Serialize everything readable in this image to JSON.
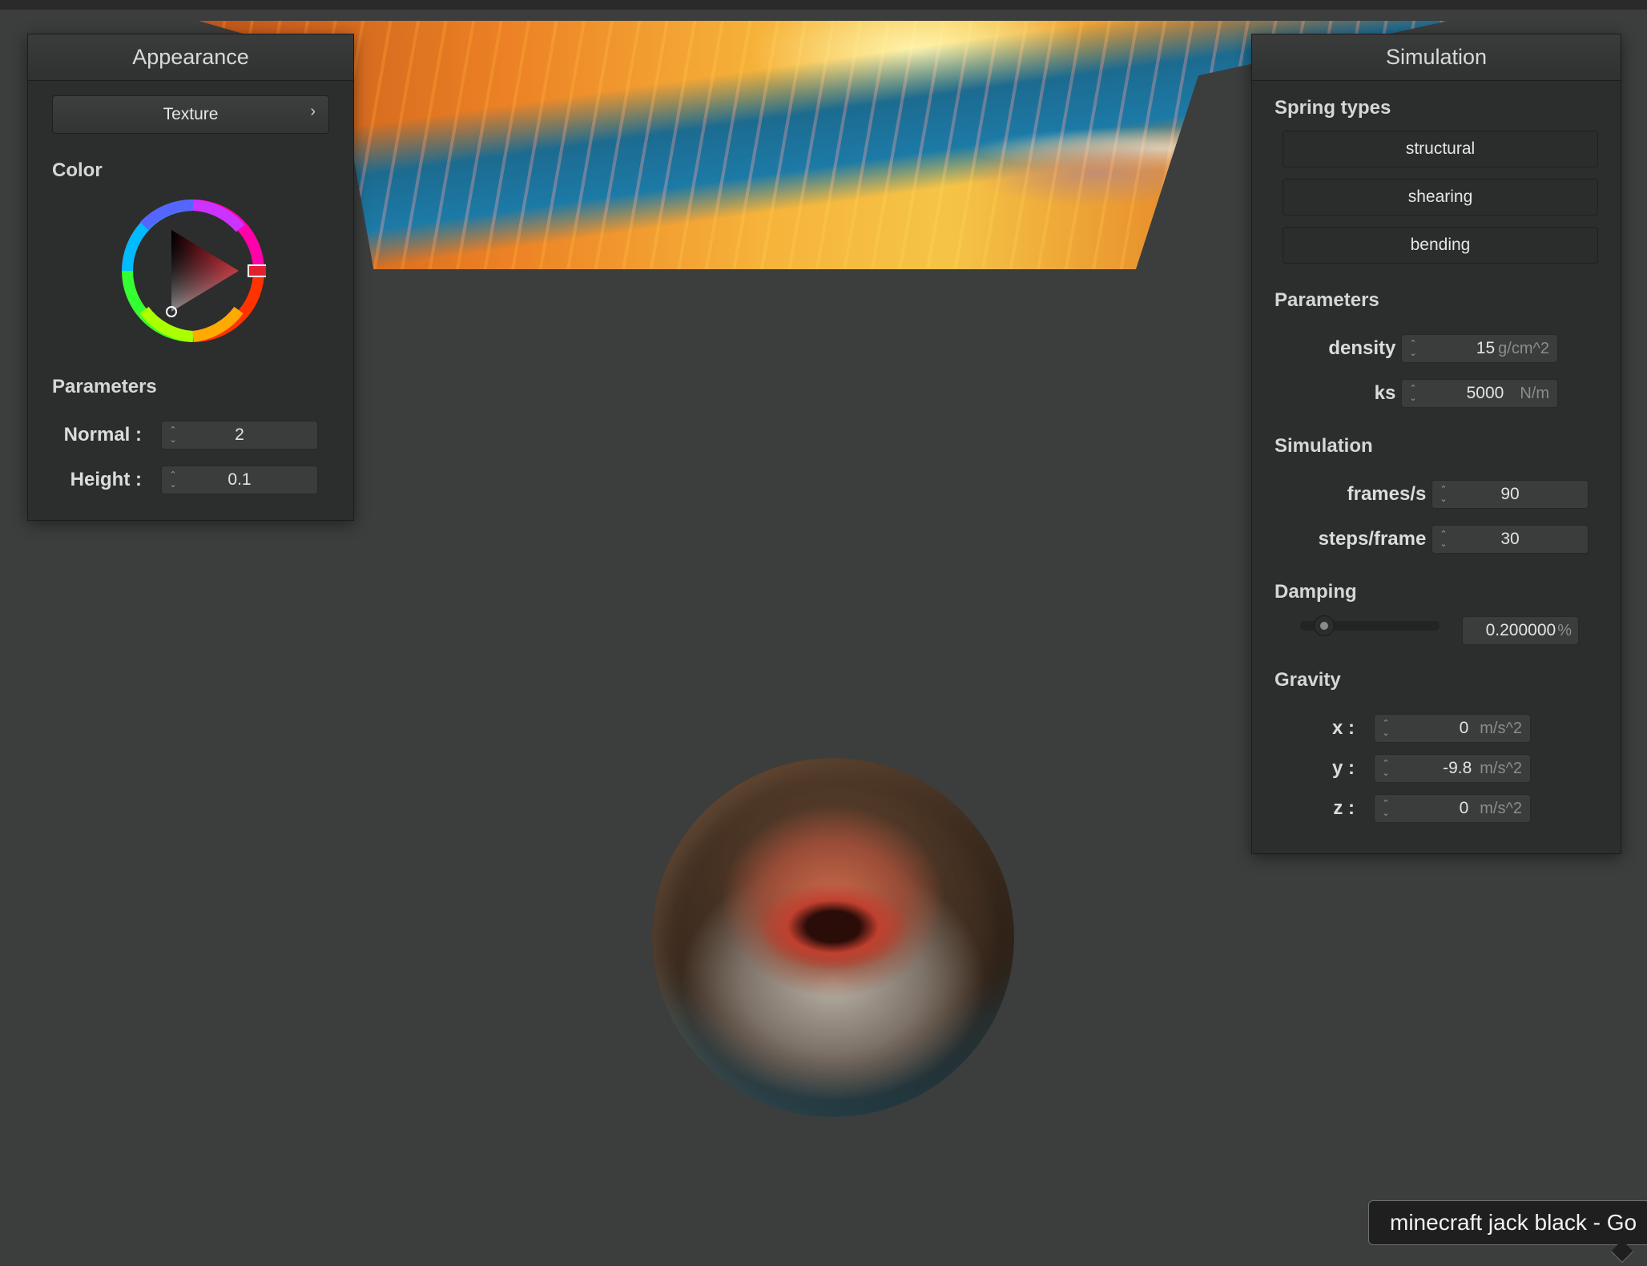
{
  "appearance": {
    "title": "Appearance",
    "texture_button": "Texture",
    "texture_chevron": "›",
    "color_label": "Color",
    "color_wheel": {
      "hue_color": "#e0202e",
      "selected_color": "#b01d24"
    },
    "parameters_label": "Parameters",
    "normal": {
      "label": "Normal :",
      "value": "2"
    },
    "height": {
      "label": "Height :",
      "value": "0.1"
    }
  },
  "simulation": {
    "title": "Simulation",
    "spring_types_label": "Spring types",
    "spring_types": [
      "structural",
      "shearing",
      "bending"
    ],
    "parameters_label": "Parameters",
    "density": {
      "label": "density :",
      "value": "15",
      "unit": "g/cm^2"
    },
    "ks": {
      "label": "ks :",
      "value": "5000",
      "unit": "N/m"
    },
    "simulation_label": "Simulation",
    "frames": {
      "label": "frames/s :",
      "value": "90"
    },
    "steps": {
      "label": "steps/frame :",
      "value": "30"
    },
    "damping_label": "Damping",
    "damping": {
      "value": "0.200000",
      "unit": "%",
      "slider_fraction": 0.2
    },
    "gravity_label": "Gravity",
    "gravity": [
      {
        "label": "x :",
        "value": "0",
        "unit": "m/s^2"
      },
      {
        "label": "y :",
        "value": "-9.8",
        "unit": "m/s^2"
      },
      {
        "label": "z :",
        "value": "0",
        "unit": "m/s^2"
      }
    ]
  },
  "tooltip": {
    "text": "minecraft jack black - Go"
  },
  "icons": {
    "spin_up": "⌃",
    "spin_down": "⌄"
  }
}
